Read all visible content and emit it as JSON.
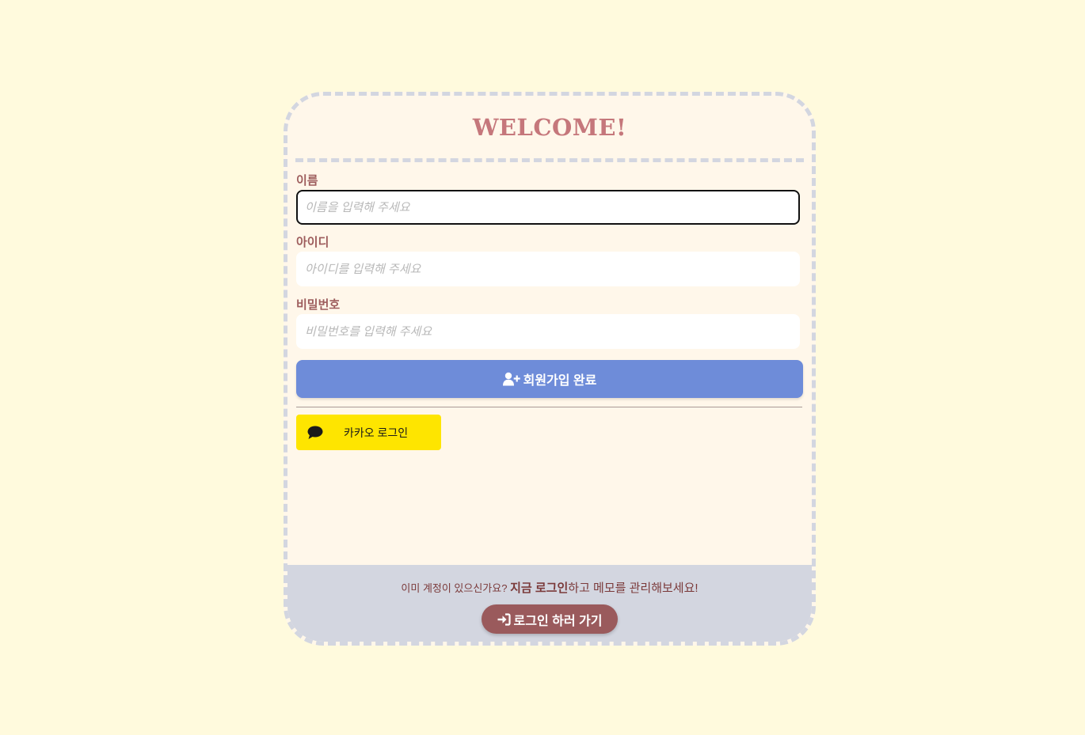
{
  "card": {
    "title": "WELCOME!"
  },
  "form": {
    "fields": [
      {
        "label": "이름",
        "placeholder": "이름을 입력해 주세요",
        "value": ""
      },
      {
        "label": "아이디",
        "placeholder": "아이디를 입력해 주세요",
        "value": ""
      },
      {
        "label": "비밀번호",
        "placeholder": "비밀번호를 입력해 주세요",
        "value": ""
      }
    ],
    "signup_label": "회원가입 완료",
    "signup_icon": "user-plus-icon",
    "kakao_label": "카카오 로그인",
    "kakao_icon": "speech-bubble-icon"
  },
  "footer": {
    "text_prefix": "이미 계정이 있으신가요?",
    "text_strong": "지금 로그인",
    "text_suffix": "하고 메모를 관리해보세요!",
    "login_label": "로그인 하러 가기",
    "login_icon": "sign-in-icon"
  },
  "colors": {
    "page_background": "#fffadd",
    "card_background": "#fff7ea",
    "card_border": "#d3d6e0",
    "title": "#c5777b",
    "label": "#9d5c5c",
    "signup_button": "#6e8cd9",
    "kakao_button": "#fee500",
    "footer_background": "#d3d6e0",
    "login_button": "#9a5a5c"
  }
}
